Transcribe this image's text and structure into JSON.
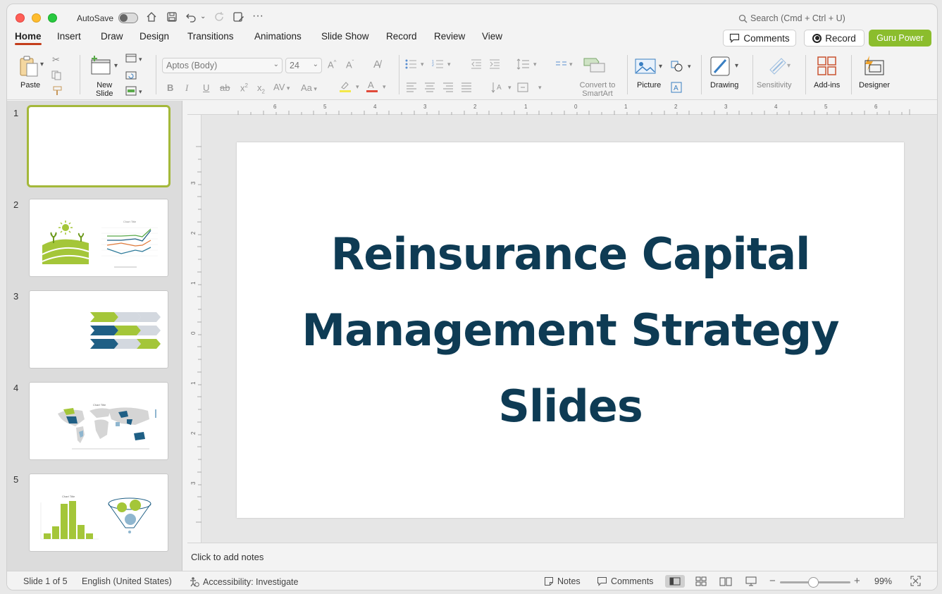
{
  "titlebar": {
    "autosave_label": "AutoSave",
    "search_placeholder": "Search (Cmd + Ctrl + U)"
  },
  "tabs": [
    "Home",
    "Insert",
    "Draw",
    "Design",
    "Transitions",
    "Animations",
    "Slide Show",
    "Record",
    "Review",
    "View"
  ],
  "active_tab": "Home",
  "header_buttons": {
    "comments": "Comments",
    "record": "Record",
    "guru": "Guru Power"
  },
  "ribbon": {
    "paste": "Paste",
    "new_slide_1": "New",
    "new_slide_2": "Slide",
    "font_name": "Aptos (Body)",
    "font_size": "24",
    "convert_1": "Convert to",
    "convert_2": "SmartArt",
    "picture": "Picture",
    "drawing": "Drawing",
    "sensitivity": "Sensitivity",
    "addins": "Add-ins",
    "designer": "Designer"
  },
  "thumbnails": {
    "numbers": [
      "1",
      "2",
      "3",
      "4",
      "5"
    ],
    "thumb2_chart_title": "Chart Title",
    "thumb4_chart_title": "Chart Title",
    "thumb5_chart_title": "Chart Title"
  },
  "ruler_h_labels": [
    "6",
    "5",
    "4",
    "3",
    "2",
    "1",
    "0",
    "1",
    "2",
    "3",
    "4",
    "5",
    "6"
  ],
  "ruler_v_labels": [
    "3",
    "2",
    "1",
    "0",
    "1",
    "2",
    "3"
  ],
  "slide": {
    "title": "Reinsurance Capital Management Strategy Slides"
  },
  "notes_placeholder": "Click to add notes",
  "status": {
    "slide_counter": "Slide 1 of 5",
    "language": "English (United States)",
    "accessibility": "Accessibility: Investigate",
    "notes": "Notes",
    "comments": "Comments",
    "zoom": "99%"
  },
  "colors": {
    "accent_green": "#8bbd2d",
    "title_navy": "#0e3b54",
    "tab_underline": "#c43e1c",
    "thumb_blue": "#1f5f85",
    "thumb_gray": "#d3d8df"
  }
}
